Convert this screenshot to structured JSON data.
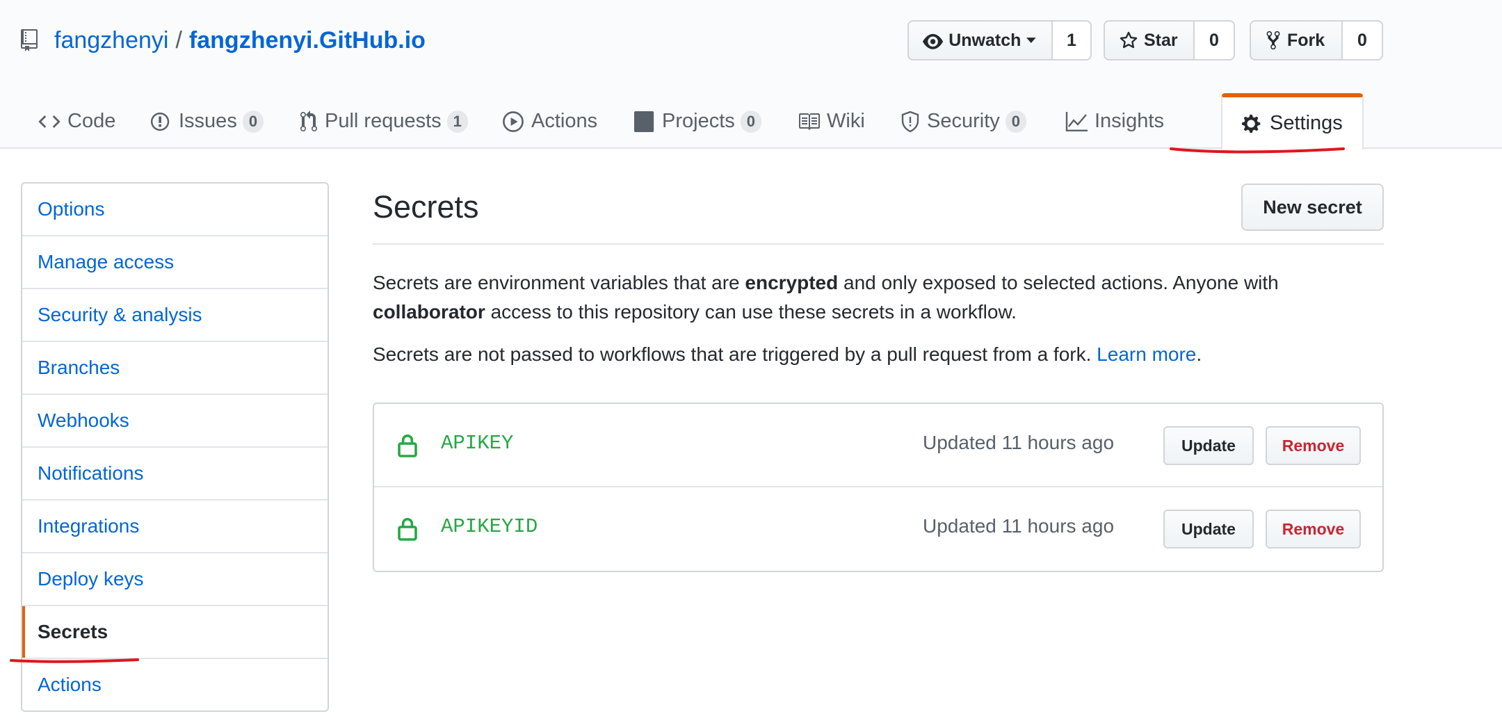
{
  "repo": {
    "owner": "fangzhenyi",
    "separator": "/",
    "name": "fangzhenyi.GitHub.io"
  },
  "actions": {
    "watch": {
      "label": "Unwatch",
      "count": "1"
    },
    "star": {
      "label": "Star",
      "count": "0"
    },
    "fork": {
      "label": "Fork",
      "count": "0"
    }
  },
  "tabs": [
    {
      "label": "Code",
      "icon": "code-icon"
    },
    {
      "label": "Issues",
      "icon": "issue-icon",
      "counter": "0"
    },
    {
      "label": "Pull requests",
      "icon": "pull-request-icon",
      "counter": "1"
    },
    {
      "label": "Actions",
      "icon": "play-icon"
    },
    {
      "label": "Projects",
      "icon": "project-icon",
      "counter": "0"
    },
    {
      "label": "Wiki",
      "icon": "book-icon"
    },
    {
      "label": "Security",
      "icon": "shield-icon",
      "counter": "0"
    },
    {
      "label": "Insights",
      "icon": "graph-icon"
    },
    {
      "label": "Settings",
      "icon": "gear-icon",
      "selected": true
    }
  ],
  "sidebar": {
    "items": [
      {
        "label": "Options"
      },
      {
        "label": "Manage access"
      },
      {
        "label": "Security & analysis"
      },
      {
        "label": "Branches"
      },
      {
        "label": "Webhooks"
      },
      {
        "label": "Notifications"
      },
      {
        "label": "Integrations"
      },
      {
        "label": "Deploy keys"
      },
      {
        "label": "Secrets",
        "selected": true
      },
      {
        "label": "Actions"
      }
    ]
  },
  "main": {
    "title": "Secrets",
    "new_button": "New secret",
    "desc1": {
      "part1": "Secrets are environment variables that are ",
      "bold1": "encrypted",
      "part2": " and only exposed to selected actions. Anyone with ",
      "bold2": "collaborator",
      "part3": " access to this repository can use these secrets in a workflow."
    },
    "desc2": {
      "text": "Secrets are not passed to workflows that are triggered by a pull request from a fork. ",
      "link": "Learn more",
      "end": "."
    },
    "secrets": [
      {
        "name": "APIKEY",
        "updated": "Updated 11 hours ago",
        "update_label": "Update",
        "remove_label": "Remove"
      },
      {
        "name": "APIKEYID",
        "updated": "Updated 11 hours ago",
        "update_label": "Update",
        "remove_label": "Remove"
      }
    ]
  },
  "colors": {
    "link": "#0366d6",
    "secret_green": "#28a745",
    "remove_red": "#cb2431",
    "selected_accent": "#e36209",
    "annotation_red": "#e0161c"
  }
}
